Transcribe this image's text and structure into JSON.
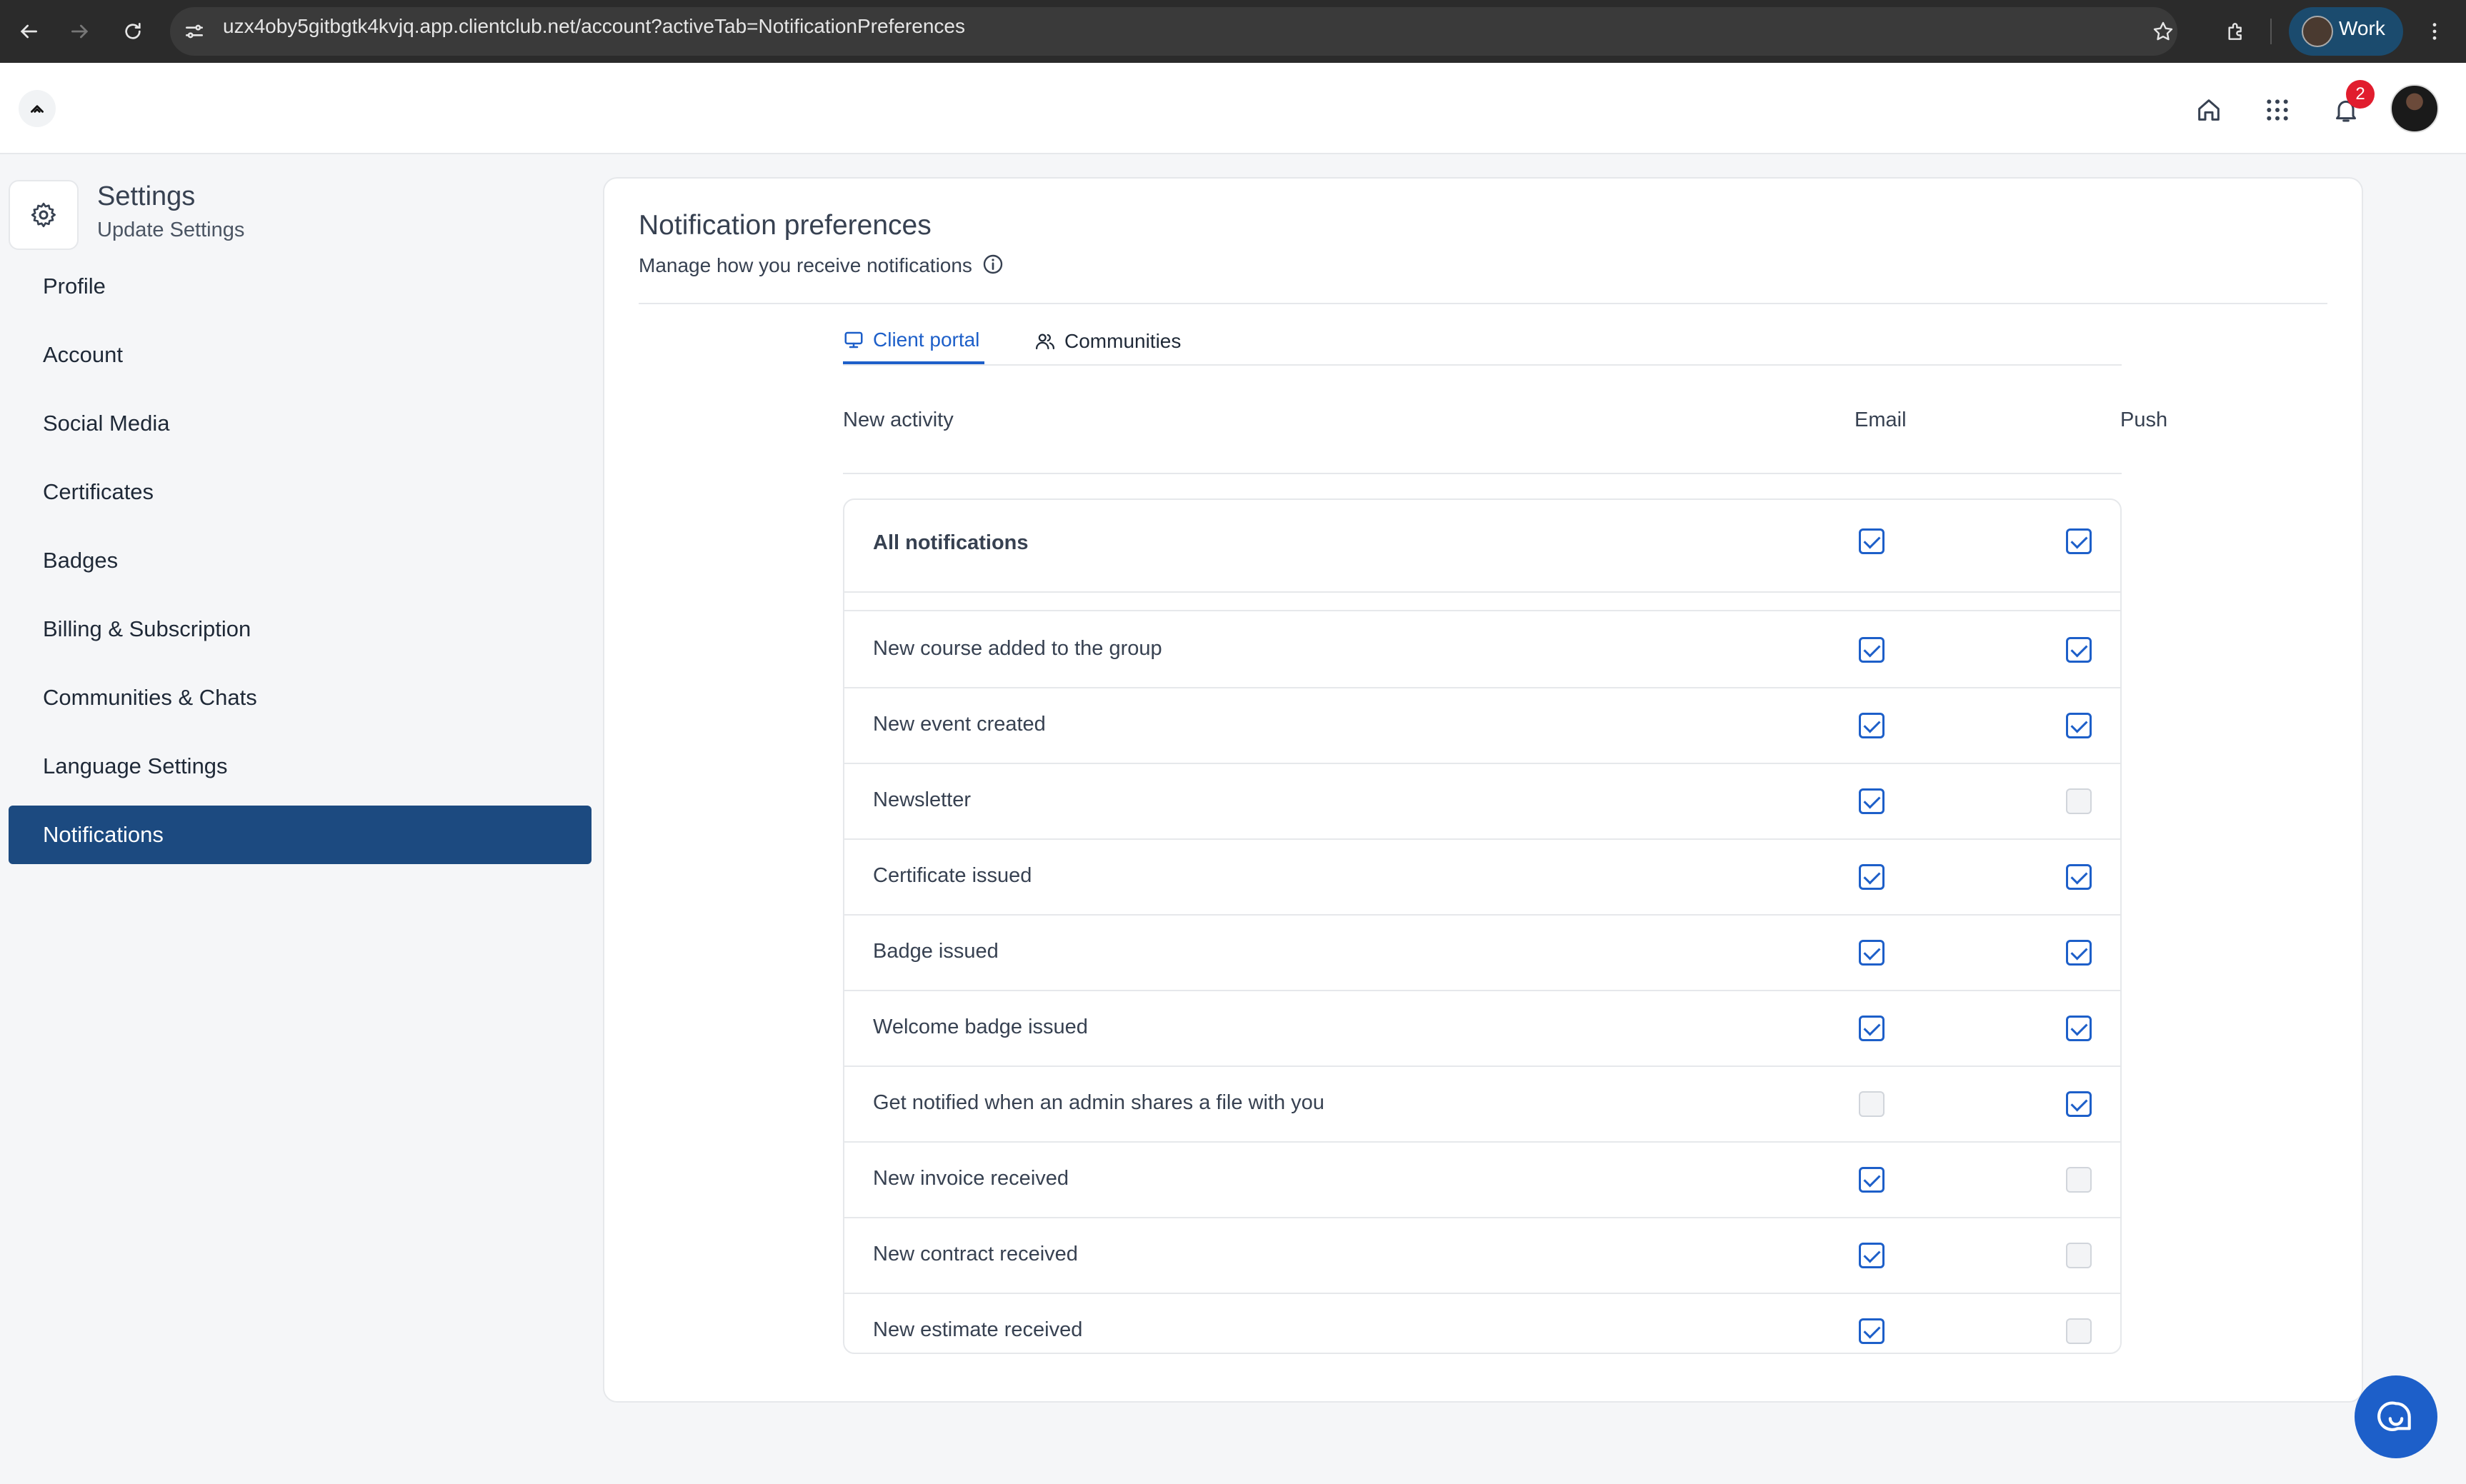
{
  "browser": {
    "url": "uzx4oby5gitbgtk4kvjq.app.clientclub.net/account?activeTab=NotificationPreferences",
    "profile_label": "Work"
  },
  "header": {
    "notification_count": "2",
    "icons": [
      "home-icon",
      "apps-grid-icon",
      "bell-icon"
    ]
  },
  "sidebar": {
    "title": "Settings",
    "subtitle": "Update Settings",
    "items": [
      {
        "label": "Profile",
        "active": false
      },
      {
        "label": "Account",
        "active": false
      },
      {
        "label": "Social Media",
        "active": false
      },
      {
        "label": "Certificates",
        "active": false
      },
      {
        "label": "Badges",
        "active": false
      },
      {
        "label": "Billing & Subscription",
        "active": false
      },
      {
        "label": "Communities & Chats",
        "active": false
      },
      {
        "label": "Language Settings",
        "active": false
      },
      {
        "label": "Notifications",
        "active": true
      }
    ]
  },
  "main": {
    "title": "Notification preferences",
    "description": "Manage how you receive notifications",
    "tabs": [
      {
        "label": "Client portal",
        "active": true
      },
      {
        "label": "Communities",
        "active": false
      }
    ],
    "columns": {
      "activity": "New activity",
      "email": "Email",
      "push": "Push"
    },
    "all_row": {
      "label": "All notifications",
      "email": true,
      "push": true
    },
    "rows": [
      {
        "label": "New course added to the group",
        "email": true,
        "push": true
      },
      {
        "label": "New event created",
        "email": true,
        "push": true
      },
      {
        "label": "Newsletter",
        "email": true,
        "push": false
      },
      {
        "label": "Certificate issued",
        "email": true,
        "push": true
      },
      {
        "label": "Badge issued",
        "email": true,
        "push": true
      },
      {
        "label": "Welcome badge issued",
        "email": true,
        "push": true
      },
      {
        "label": "Get notified when an admin shares a file with you",
        "email": false,
        "push": true
      },
      {
        "label": "New invoice received",
        "email": true,
        "push": false
      },
      {
        "label": "New contract received",
        "email": true,
        "push": false
      },
      {
        "label": "New estimate received",
        "email": true,
        "push": false
      }
    ]
  },
  "colors": {
    "accent": "#1d5fc9",
    "sidebar_active": "#1c4a80",
    "badge": "#e11d2e"
  }
}
